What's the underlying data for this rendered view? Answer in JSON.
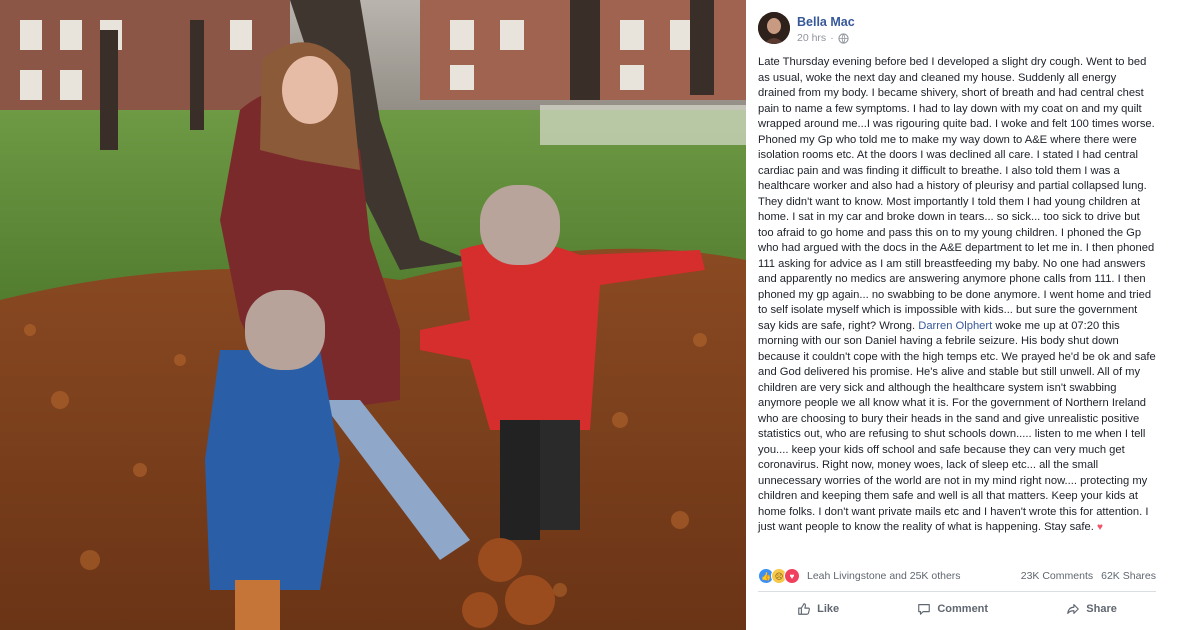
{
  "post": {
    "author": "Bella Mac",
    "time": "20 hrs",
    "text_part1": "Late Thursday evening before bed I developed a slight dry cough. Went to bed as usual, woke the next day and cleaned my house. Suddenly all energy drained from my body. I became shivery, short of breath and had central chest pain to name a few symptoms. I had to lay down with my coat on and my quilt wrapped around me...I was rigouring quite bad. I woke and felt 100 times worse. Phoned my Gp who told me to make my way down to A&E where there were isolation rooms etc. At the doors I was declined all care. I stated I had central cardiac pain and was finding it difficult to breathe. I also told them I was a healthcare worker and also had a history of pleurisy and partial collapsed lung. They didn't want to know. Most importantly I told them I had young children at home. I sat in my car and broke down in tears... so sick... too sick to drive but too afraid to go home and pass this on to my young children. I phoned the Gp who had argued with the docs in the A&E department to let me in. I then phoned 111 asking for advice as I am still breastfeeding my baby. No one had answers and apparently no medics are answering anymore phone calls from 111. I then phoned my gp again... no swabbing to be done anymore. I went home and tried to self isolate myself which is impossible with kids... but sure the government say kids are safe, right? Wrong. ",
    "mention": "Darren Olphert",
    "text_part2": " woke me up at 07:20 this morning with our son Daniel having a febrile seizure. His body shut down because it couldn't cope with the high temps etc. We prayed he'd be ok and safe and God delivered his promise. He's alive and stable but still unwell. All of my children are very sick and although the healthcare system isn't swabbing anymore people we all know what it is. For the government of Northern Ireland who are choosing to bury their heads in the sand and give unrealistic positive statistics out, who are refusing to shut schools down..... listen to me when I tell you.... keep your kids off school and safe because they can very much get coronavirus. Right now, money woes, lack of sleep etc... all the small unnecessary worries of the world are not in my mind right now.... protecting my children and keeping them safe and well is all that matters. Keep your kids at home folks. I don't want private mails etc and I haven't wrote this for attention. I just want people to know the reality of what is happening. Stay safe. ",
    "end_emoji": "♥"
  },
  "reactions": {
    "names": "Leah Livingstone and 25K others",
    "comments": "23K Comments",
    "shares": "62K Shares"
  },
  "actions": {
    "like": "Like",
    "comment": "Comment",
    "share": "Share"
  },
  "icons": {
    "like": "thumbs-up-icon",
    "comment": "speech-bubble-icon",
    "share": "share-arrow-icon",
    "privacy": "globe-icon",
    "reactions": [
      "like-reaction-icon",
      "sad-reaction-icon",
      "love-reaction-icon"
    ]
  },
  "colors": {
    "link": "#365899",
    "muted": "#90949c",
    "text": "#1d2129",
    "action": "#606770",
    "like_blue": "#3b8ff5",
    "love_red": "#f0405f",
    "sad_yellow": "#f7c94a"
  }
}
